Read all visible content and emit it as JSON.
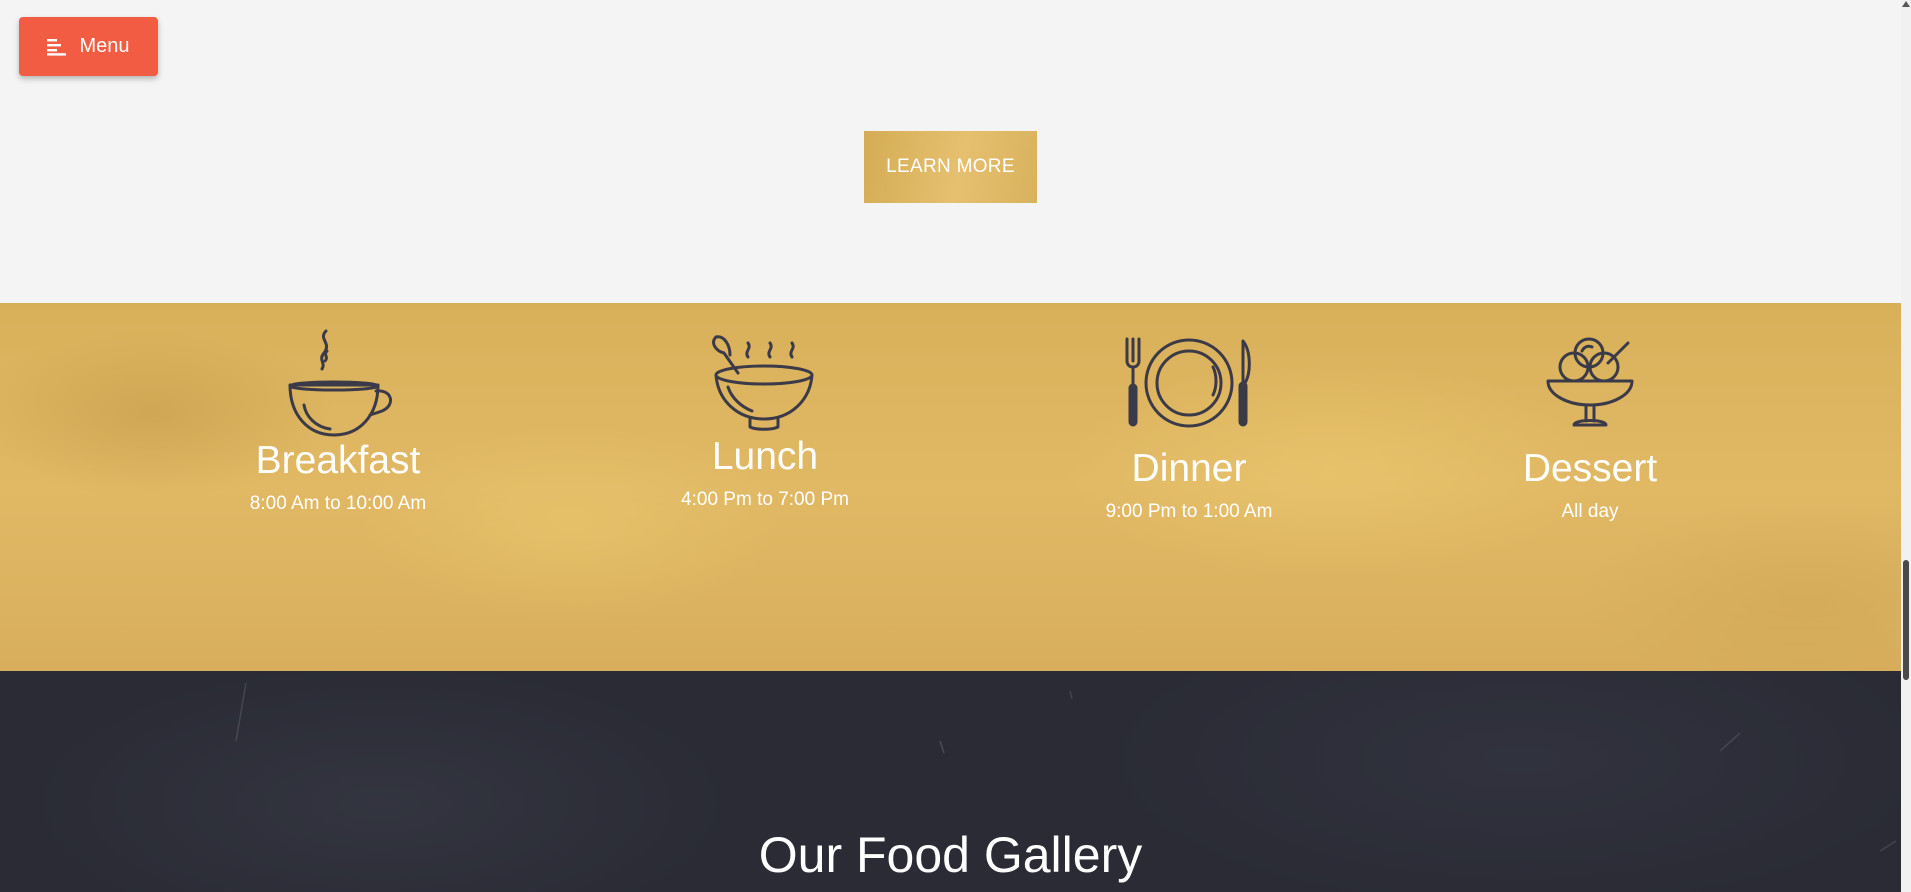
{
  "header": {
    "menu_label": "Menu",
    "menu_icon": "menu-lines-icon",
    "accent_color": "#f25c43"
  },
  "intro": {
    "learn_more_label": "LEARN MORE",
    "button_color": "#d9b25d"
  },
  "meals": [
    {
      "icon": "coffee-cup-icon",
      "title": "Breakfast",
      "hours": "8:00 Am to 10:00 Am"
    },
    {
      "icon": "soup-bowl-icon",
      "title": "Lunch",
      "hours": "4:00 Pm to 7:00 Pm"
    },
    {
      "icon": "plate-cutlery-icon",
      "title": "Dinner",
      "hours": "9:00 Pm to 1:00 Am"
    },
    {
      "icon": "ice-cream-icon",
      "title": "Dessert",
      "hours": "All day"
    }
  ],
  "gallery": {
    "title": "Our Food Gallery"
  }
}
